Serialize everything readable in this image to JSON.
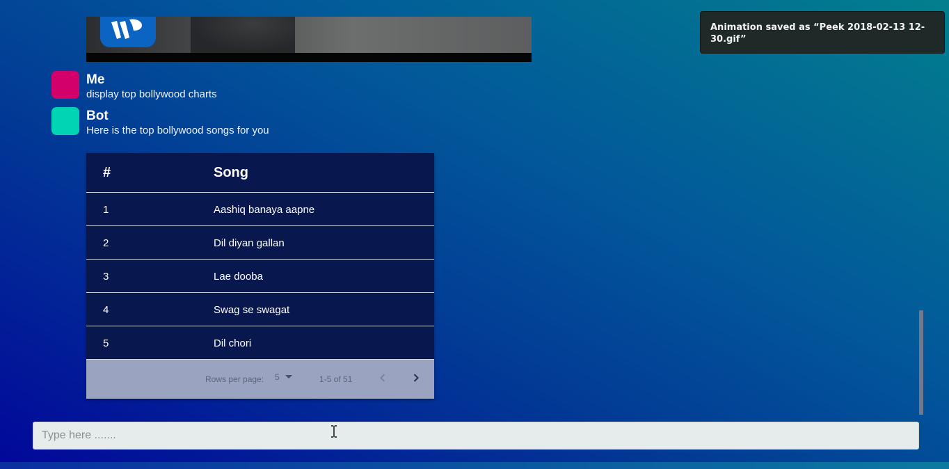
{
  "messages": [
    {
      "sender": "Me",
      "text": "display top bollywood charts",
      "avatar_color": "#d3006c"
    },
    {
      "sender": "Bot",
      "text": "Here is the top bollywood songs for you",
      "avatar_color": "#00d4b4"
    }
  ],
  "table": {
    "headers": [
      "#",
      "Song"
    ],
    "rows": [
      [
        "1",
        "Aashiq banaya aapne"
      ],
      [
        "2",
        "Dil diyan gallan"
      ],
      [
        "3",
        "Lae dooba"
      ],
      [
        "4",
        "Swag se swagat"
      ],
      [
        "5",
        "Dil chori"
      ]
    ],
    "footer": {
      "rows_per_page_label": "Rows per page:",
      "rows_per_page_value": "5",
      "range_text": "1-5 of 51",
      "prev_icon": "chevron-left-icon",
      "next_icon": "chevron-right-icon"
    }
  },
  "input": {
    "placeholder": "Type here ......."
  },
  "toast": {
    "text": "Animation saved as “Peek 2018-02-13 12-30.gif”"
  },
  "media": {
    "logo_icon": "warner-music-logo"
  },
  "colors": {
    "table_bg": "#08174e",
    "footer_bg": "#9aa3c0",
    "me_avatar": "#d3006c",
    "bot_avatar": "#00d4b4",
    "toast_bg": "#1f2a28"
  }
}
